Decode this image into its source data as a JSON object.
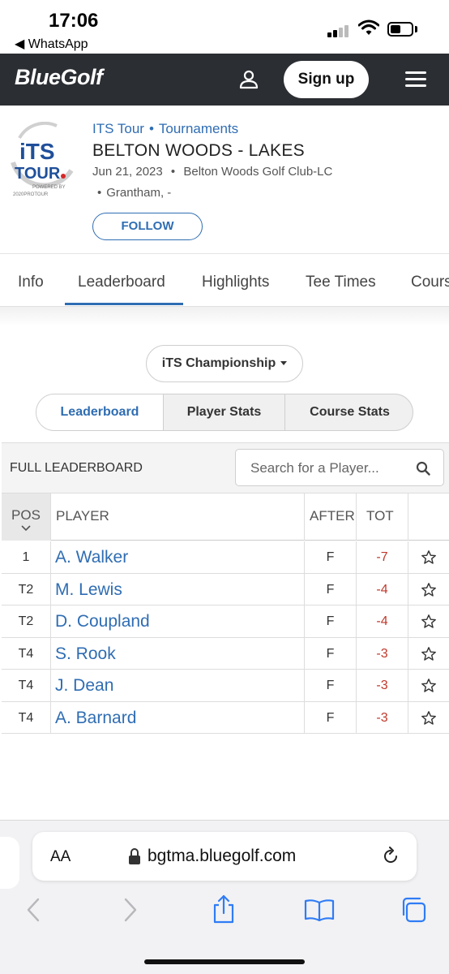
{
  "status_bar": {
    "time": "17:06",
    "back_app": "◀ WhatsApp"
  },
  "header": {
    "logo": "BlueGolf",
    "signup_label": "Sign up"
  },
  "tournament": {
    "logo_text": "iTS TOUR.",
    "logo_powered": "POWERED BY",
    "breadcrumb": [
      "ITS Tour",
      "Tournaments"
    ],
    "title": "BELTON WOODS - LAKES",
    "date": "Jun 21, 2023",
    "venue": "Belton Woods Golf Club-LC",
    "location": "Grantham, -",
    "follow_label": "FOLLOW"
  },
  "tabs": [
    {
      "label": "Info"
    },
    {
      "label": "Leaderboard",
      "active": true
    },
    {
      "label": "Highlights"
    },
    {
      "label": "Tee Times"
    },
    {
      "label": "Cours"
    }
  ],
  "event_select": {
    "value": "iTS Championship"
  },
  "segments": [
    {
      "label": "Leaderboard",
      "active": true
    },
    {
      "label": "Player Stats"
    },
    {
      "label": "Course Stats"
    }
  ],
  "leaderboard": {
    "title": "FULL LEADERBOARD",
    "search_placeholder": "Search for a Player...",
    "columns": {
      "pos": "POS",
      "player": "PLAYER",
      "after": "AFTER",
      "tot": "TOT"
    },
    "rows": [
      {
        "pos": "1",
        "player": "A. Walker",
        "after": "F",
        "tot": "-7"
      },
      {
        "pos": "T2",
        "player": "M. Lewis",
        "after": "F",
        "tot": "-4"
      },
      {
        "pos": "T2",
        "player": "D. Coupland",
        "after": "F",
        "tot": "-4"
      },
      {
        "pos": "T4",
        "player": "S. Rook",
        "after": "F",
        "tot": "-3"
      },
      {
        "pos": "T4",
        "player": "J. Dean",
        "after": "F",
        "tot": "-3"
      },
      {
        "pos": "T4",
        "player": "A. Barnard",
        "after": "F",
        "tot": "-3"
      }
    ]
  },
  "browser": {
    "aa_label": "AA",
    "url": "bgtma.bluegolf.com"
  },
  "colors": {
    "brand_blue": "#2f6db3",
    "header_bg": "#2b2e33",
    "score_red": "#c0392b"
  }
}
